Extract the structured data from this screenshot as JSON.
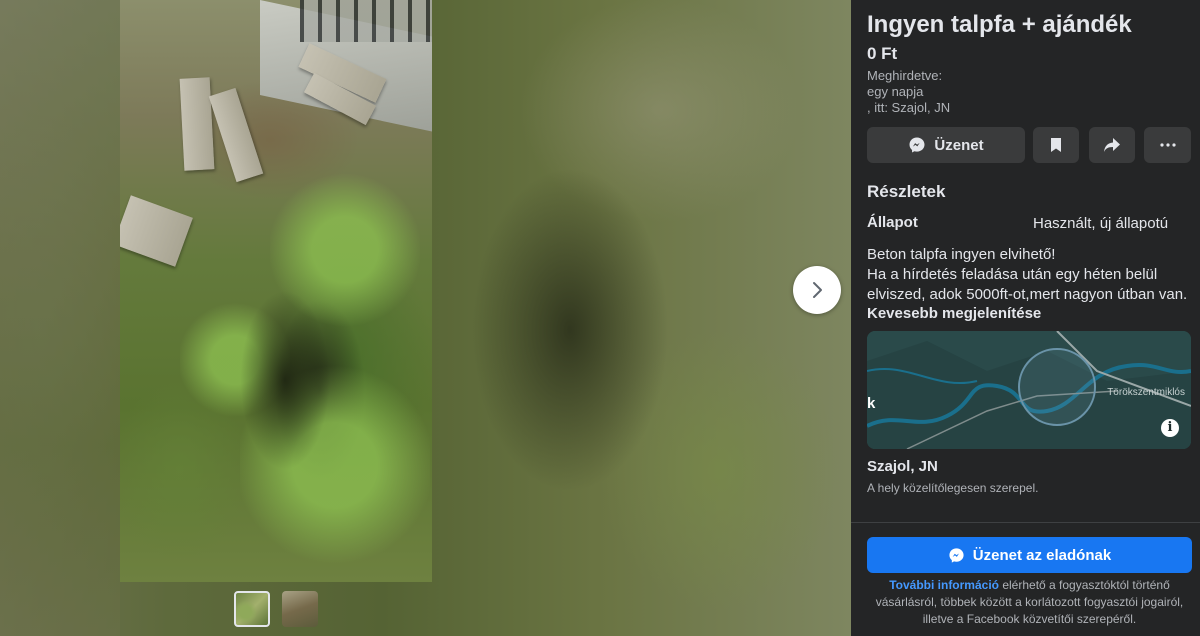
{
  "listing": {
    "title": "Ingyen talpfa + ajándék",
    "price": "0 Ft",
    "listed_label": "Meghirdetve:",
    "listed_time": "egy napja",
    "listed_location": ", itt: Szajol, JN"
  },
  "actions": {
    "message_label": "Üzenet",
    "save_icon": "bookmark-icon",
    "share_icon": "share-icon",
    "more_icon": "more-icon"
  },
  "details": {
    "section_title": "Részletek",
    "condition_label": "Állapot",
    "condition_value": "Használt, új állapotú",
    "description_lines": [
      "Beton talpfa ingyen elvihető!",
      "Ha a hírdetés feladása után egy héten belül",
      "elviszed, adok 5000ft-ot,mert nagyon útban van."
    ],
    "see_less_label": "Kevesebb megjelenítése"
  },
  "map": {
    "town_label": "Törökszentmiklós",
    "edge_label": "k",
    "info_icon": "info-icon",
    "colors": {
      "land": "#2a4a4a",
      "river": "#1a6f8c",
      "road": "#9aa7a7"
    }
  },
  "location": {
    "name": "Szajol, JN",
    "note": "A hely közelítőlegesen szerepel."
  },
  "cta": {
    "label": "Üzenet az eladónak",
    "color": "#1877f2"
  },
  "footnote": {
    "link_text": "További információ",
    "text": " elérhető a fogyasztóktól történő vásárlásról, többek között a korlátozott fogyasztói jogairól, illetve a Facebook közvetítői szerepéről."
  },
  "gallery": {
    "next_icon": "chevron-right-icon",
    "thumbnail_count": 2,
    "selected_thumbnail": 1
  }
}
